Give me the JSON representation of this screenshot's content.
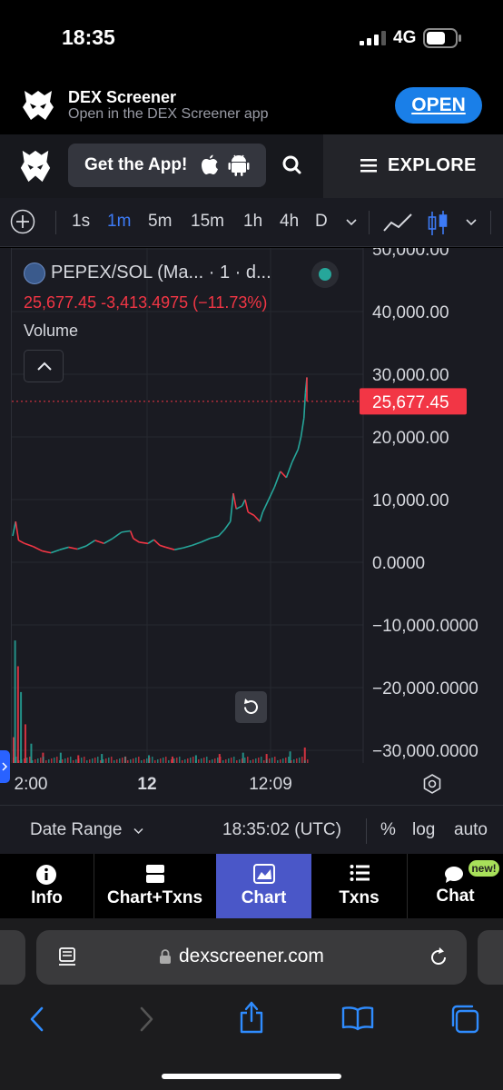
{
  "status_bar": {
    "time": "18:35",
    "network": "4G"
  },
  "app_banner": {
    "title": "DEX Screener",
    "subtitle": "Open in the DEX Screener app",
    "open_label": "OPEN"
  },
  "header": {
    "get_app_label": "Get the App!",
    "explore_label": "EXPLORE"
  },
  "toolbar": {
    "intervals": [
      "1s",
      "1m",
      "5m",
      "15m",
      "1h",
      "4h",
      "D"
    ],
    "active_interval": "1m"
  },
  "legend": {
    "title": "PEPEX/SOL (Ma... · 1 · d...",
    "price_line": "25,677.45  -3,413.4975 (−11.73%)",
    "volume_label": "Volume"
  },
  "chart_data": {
    "type": "line",
    "pair": "PEPEX/SOL",
    "interval": "1m",
    "last_price": 25677.45,
    "last_price_label": "25,677.45",
    "change": -3413.4975,
    "change_pct": -11.73,
    "y_ticks": [
      "50,000.00",
      "40,000.00",
      "30,000.00",
      "20,000.00",
      "10,000.00",
      "0.0000",
      "−10,000.0000",
      "−20,000.0000",
      "−30,000.0000"
    ],
    "y_tick_values": [
      50000,
      40000,
      30000,
      20000,
      10000,
      0,
      -10000,
      -20000,
      -30000
    ],
    "x_ticks": [
      "2:00",
      "12",
      "12:09"
    ],
    "ylim": [
      -31500,
      51500
    ],
    "price_series": [
      [
        0.0,
        4200
      ],
      [
        0.01,
        6500
      ],
      [
        0.02,
        3500
      ],
      [
        0.04,
        3000
      ],
      [
        0.07,
        2500
      ],
      [
        0.1,
        1800
      ],
      [
        0.13,
        1500
      ],
      [
        0.16,
        2000
      ],
      [
        0.19,
        2400
      ],
      [
        0.22,
        2100
      ],
      [
        0.25,
        2600
      ],
      [
        0.28,
        3500
      ],
      [
        0.31,
        3000
      ],
      [
        0.34,
        3800
      ],
      [
        0.37,
        4800
      ],
      [
        0.4,
        5000
      ],
      [
        0.41,
        3800
      ],
      [
        0.43,
        3200
      ],
      [
        0.46,
        3000
      ],
      [
        0.48,
        3600
      ],
      [
        0.5,
        2700
      ],
      [
        0.52,
        2400
      ],
      [
        0.55,
        2000
      ],
      [
        0.58,
        2300
      ],
      [
        0.61,
        2700
      ],
      [
        0.64,
        3200
      ],
      [
        0.67,
        3800
      ],
      [
        0.7,
        4200
      ],
      [
        0.72,
        5200
      ],
      [
        0.74,
        6500
      ],
      [
        0.75,
        11000
      ],
      [
        0.76,
        8500
      ],
      [
        0.78,
        9000
      ],
      [
        0.79,
        10000
      ],
      [
        0.8,
        8000
      ],
      [
        0.82,
        7500
      ],
      [
        0.84,
        6500
      ],
      [
        0.85,
        8000
      ],
      [
        0.87,
        10000
      ],
      [
        0.89,
        12000
      ],
      [
        0.91,
        14500
      ],
      [
        0.93,
        13500
      ],
      [
        0.95,
        16000
      ],
      [
        0.97,
        18000
      ],
      [
        0.98,
        20000
      ],
      [
        0.99,
        23000
      ],
      [
        0.995,
        27000
      ],
      [
        1.0,
        29500
      ],
      [
        1.0,
        25677
      ]
    ],
    "volume_series": [
      [
        0.0,
        0.2
      ],
      [
        0.005,
        0.95
      ],
      [
        0.015,
        0.75
      ],
      [
        0.025,
        0.55
      ],
      [
        0.04,
        0.3
      ],
      [
        0.06,
        0.15
      ],
      [
        0.1,
        0.08
      ],
      [
        0.16,
        0.08
      ],
      [
        0.22,
        0.06
      ],
      [
        0.3,
        0.07
      ],
      [
        0.38,
        0.05
      ],
      [
        0.46,
        0.06
      ],
      [
        0.54,
        0.05
      ],
      [
        0.62,
        0.06
      ],
      [
        0.7,
        0.07
      ],
      [
        0.78,
        0.08
      ],
      [
        0.86,
        0.07
      ],
      [
        0.94,
        0.09
      ],
      [
        0.99,
        0.12
      ]
    ],
    "up_color": "#26a69a",
    "down_color": "#f23645"
  },
  "date_bar": {
    "date_range_label": "Date Range",
    "time_utc": "18:35:02 (UTC)",
    "percent_label": "%",
    "log_label": "log",
    "auto_label": "auto"
  },
  "bottom_tabs": [
    {
      "id": "info",
      "label": "Info"
    },
    {
      "id": "chart_txns",
      "label": "Chart+Txns"
    },
    {
      "id": "chart",
      "label": "Chart"
    },
    {
      "id": "txns",
      "label": "Txns"
    },
    {
      "id": "chat",
      "label": "Chat"
    }
  ],
  "active_tab": "chart",
  "chat_badge": "new!",
  "safari": {
    "url": "dexscreener.com"
  },
  "colors": {
    "accent": "#1a7fe8",
    "active_interval": "#3d7bf6",
    "active_tab": "#4a57c8",
    "price_line": "#f23645"
  }
}
